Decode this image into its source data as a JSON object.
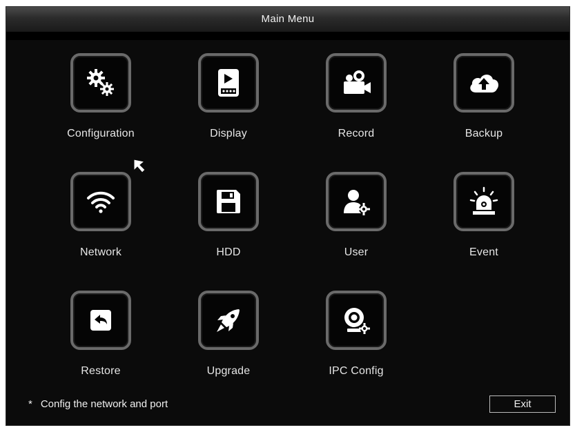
{
  "window": {
    "title": "Main Menu"
  },
  "menu": {
    "items": [
      {
        "label": "Configuration",
        "icon": "gears-icon"
      },
      {
        "label": "Display",
        "icon": "display-icon"
      },
      {
        "label": "Record",
        "icon": "camera-icon"
      },
      {
        "label": "Backup",
        "icon": "cloud-upload-icon"
      },
      {
        "label": "Network",
        "icon": "wifi-icon"
      },
      {
        "label": "HDD",
        "icon": "floppy-icon"
      },
      {
        "label": "User",
        "icon": "user-gear-icon"
      },
      {
        "label": "Event",
        "icon": "alarm-siren-icon"
      },
      {
        "label": "Restore",
        "icon": "restore-icon"
      },
      {
        "label": "Upgrade",
        "icon": "rocket-icon"
      },
      {
        "label": "IPC Config",
        "icon": "ipcam-gear-icon"
      }
    ]
  },
  "footer": {
    "hint_marker": "*",
    "hint": "Config the network and port",
    "exit_label": "Exit"
  },
  "colors": {
    "background": "#0b0b0b",
    "tile_border": "#6a6a6a",
    "text": "#e6e6e6"
  }
}
